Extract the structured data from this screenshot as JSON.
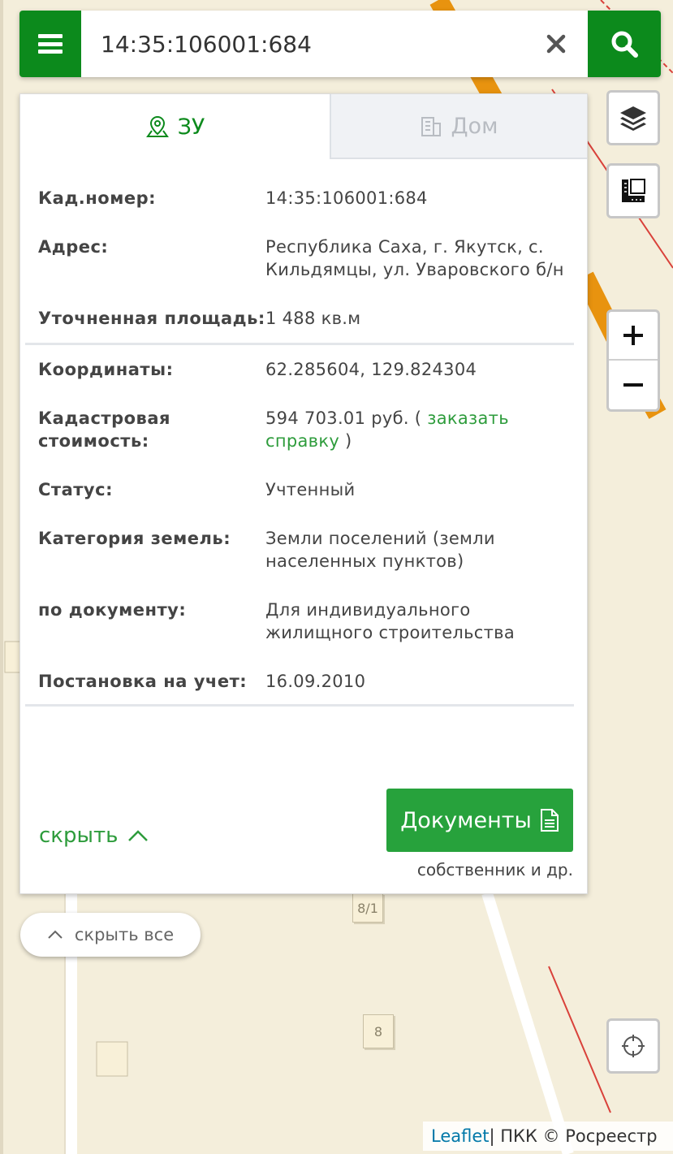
{
  "search": {
    "value": "14:35:106001:684"
  },
  "tabs": [
    {
      "label": "ЗУ",
      "icon": "map-pin-icon",
      "active": true
    },
    {
      "label": "Дом",
      "icon": "building-icon",
      "active": false
    }
  ],
  "info": {
    "cad_number": {
      "label": "Кад.номер:",
      "value": "14:35:106001:684"
    },
    "address": {
      "label": "Адрес:",
      "value": "Республика Саха, г. Якутск, с. Кильдямцы, ул. Уваровского б/н"
    },
    "area": {
      "label": "Уточненная площадь:",
      "value": "1 488 кв.м"
    },
    "coordinates": {
      "label": "Координаты:",
      "value": "62.285604, 129.824304"
    },
    "cost": {
      "label": "Кадастровая стоимость:",
      "value": "594 703.01 руб.",
      "link_open": " ( ",
      "link": "заказать справку",
      "link_close": " )"
    },
    "status": {
      "label": "Статус:",
      "value": "Учтенный"
    },
    "category": {
      "label": "Категория земель:",
      "value": "Земли поселений (земли населенных пунктов)"
    },
    "by_document": {
      "label": "по документу:",
      "value": "Для индивидуального жилищного строительства"
    },
    "registered": {
      "label": "Постановка на учет:",
      "value": "16.09.2010"
    }
  },
  "actions": {
    "hide_label": "скрыть",
    "documents_label": "Документы",
    "documents_sub": "собственник и др.",
    "hide_all_label": "скрыть все"
  },
  "map": {
    "house_labels": [
      "8/1",
      "8"
    ],
    "attribution_link": "Leaflet",
    "attribution_text": " | ПКК © Росреестр"
  },
  "colors": {
    "brand_green": "#0c8a1c",
    "link_green": "#2e9c3c",
    "road_orange": "#e8930f",
    "boundary_red": "#d9413a",
    "map_background": "#f4eedb"
  }
}
